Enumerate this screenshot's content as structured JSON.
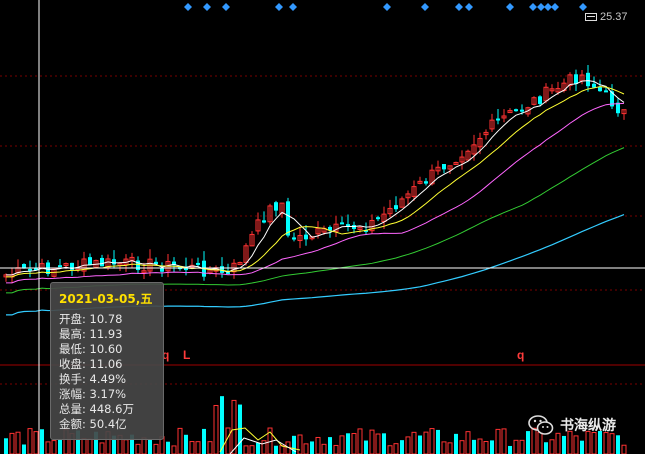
{
  "price_label": "25.37",
  "markers": {
    "m1": "q",
    "m2": "L",
    "m3": "q"
  },
  "tooltip": {
    "date": "2021-03-05,五",
    "rows": [
      {
        "label": "开盘",
        "value": "10.78"
      },
      {
        "label": "最高",
        "value": "11.93"
      },
      {
        "label": "最低",
        "value": "10.60"
      },
      {
        "label": "收盘",
        "value": "11.06"
      },
      {
        "label": "换手",
        "value": "4.49%"
      },
      {
        "label": "涨幅",
        "value": "3.17%"
      },
      {
        "label": "总量",
        "value": "448.6万"
      },
      {
        "label": "金额",
        "value": "50.4亿"
      }
    ],
    "row_texts": [
      "开盘: 10.78",
      "最高: 11.93",
      "最低: 10.60",
      "收盘: 11.06",
      "换手: 4.49%",
      "涨幅: 3.17%",
      "总量: 448.6万",
      "金额: 50.4亿"
    ]
  },
  "watermark": {
    "text": "书海纵游",
    "icon": "wechat-icon"
  },
  "colors": {
    "background": "#000000",
    "up": "#ff3232",
    "down": "#00ffff",
    "ma_white": "#ffffff",
    "ma_yellow": "#ffff33",
    "ma_magenta": "#ff66ff",
    "ma_green": "#33cc33",
    "ma_cyan": "#33ccff",
    "grid": "#7a0000",
    "diamond": "#3399ff"
  },
  "chart_data": {
    "type": "candlestick",
    "last_price": 25.37,
    "crosshair_date": "2021-03-05"
  }
}
